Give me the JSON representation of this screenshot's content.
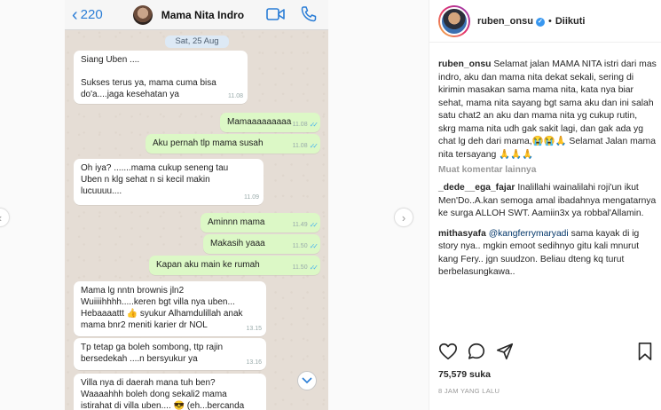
{
  "chat": {
    "back_count": "220",
    "contact_name": "Mama Nita Indro",
    "date": "Sat, 25 Aug",
    "messages": [
      {
        "dir": "in",
        "text": "Siang Uben ....\n\nSukses terus ya,  mama cuma bisa\ndo'a....jaga kesehatan ya",
        "time": "11.08"
      },
      {
        "dir": "out",
        "text": "Mamaaaaaaaaa",
        "time": "11.08"
      },
      {
        "dir": "out",
        "text": "Aku pernah tlp mama susah",
        "time": "11.08"
      },
      {
        "dir": "in",
        "text": "Oh iya?  .......mama cukup seneng tau\nUben n klg sehat n si kecil makin\nlucuuuu....",
        "time": "11.09"
      },
      {
        "dir": "out",
        "text": "Aminnn mama",
        "time": "11.49"
      },
      {
        "dir": "out",
        "text": "Makasih yaaa",
        "time": "11.50"
      },
      {
        "dir": "out",
        "text": "Kapan aku main ke rumah",
        "time": "11.50"
      },
      {
        "dir": "in",
        "text": "Mama lg nntn brownis jln2\nWuiiiihhhh.....keren bgt villa nya uben...\nHebaaaattt 👍 syukur Alhamdulillah anak\nmama bnr2 meniti karier dr NOL",
        "time": "13.15"
      },
      {
        "dir": "in",
        "text": "Tp tetap ga boleh sombong,  ttp rajin\nbersedekah ....n bersyukur ya",
        "time": "13.16"
      },
      {
        "dir": "in",
        "text": "Villa nya di daerah mana tuh ben?\nWaaaahhh boleh dong sekali2 mama\nistirahat di villa uben.... 😎  (eh...bercanda",
        "time": ""
      }
    ]
  },
  "instagram": {
    "username": "ruben_onsu",
    "follow_status": "Diikuti",
    "caption": "Selamat jalan MAMA NITA istri dari mas indro, aku dan mama nita dekat sekali, sering di kirimin masakan sama mama nita, kata nya biar sehat, mama nita sayang bgt sama aku dan ini salah satu chat2 an aku dan mama nita yg cukup rutin, skrg mama nita udh gak sakit lagi, dan gak ada yg chat lg deh dari mama,😭😭🙏 Selamat Jalan mama nita tersayang 🙏🙏🙏",
    "load_more": "Muat komentar lainnya",
    "comments": [
      {
        "user": "_dede__ega_fajar",
        "text": "Inalillahi wainalilahi roji'un ikut Men'Do..A.kan semoga amal ibadahnya mengatarnya ke surga ALLOH SWT. Aamiin3x ya robbal'Allamin."
      },
      {
        "user": "mithasyafa",
        "mention": "@kangferrymaryadi",
        "text": "sama kayak di ig story nya.. mgkin emoot sedihnyo gitu kali mnurut kang Fery.. jgn suudzon. Beliau dteng kq turut berbelasungkawa.."
      }
    ],
    "likes": "75,579 suka",
    "time_ago": "8 JAM YANG LALU"
  },
  "colors": {
    "wa_blue": "#2a7dd6",
    "out_bubble": "#dcf8c6",
    "in_bubble": "#ffffff",
    "ig_blue": "#3897f0"
  }
}
